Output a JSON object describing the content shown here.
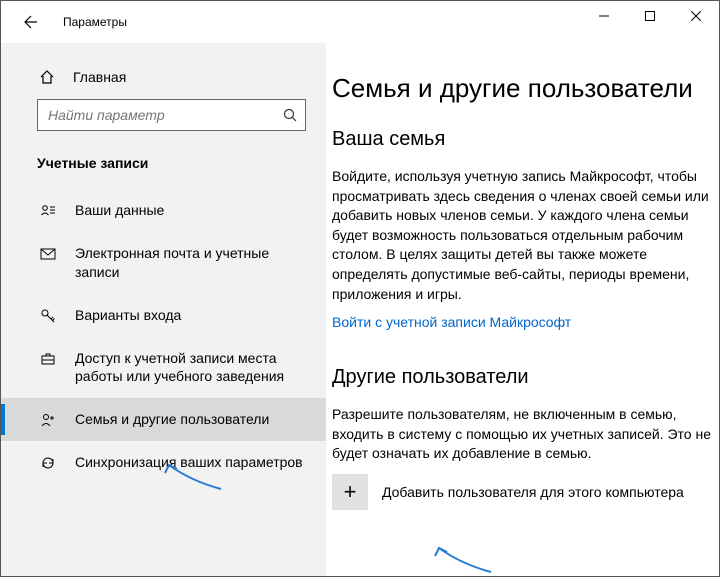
{
  "window": {
    "title": "Параметры"
  },
  "sidebar": {
    "home": "Главная",
    "search_placeholder": "Найти параметр",
    "section": "Учетные записи",
    "items": [
      {
        "label": "Ваши данные"
      },
      {
        "label": "Электронная почта и учетные записи"
      },
      {
        "label": "Варианты входа"
      },
      {
        "label": "Доступ к учетной записи места работы или учебного заведения"
      },
      {
        "label": "Семья и другие пользователи"
      },
      {
        "label": "Синхронизация ваших параметров"
      }
    ]
  },
  "main": {
    "title": "Семья и другие пользователи",
    "family": {
      "heading": "Ваша семья",
      "text": "Войдите, используя учетную запись Майкрософт, чтобы просматривать здесь сведения о членах своей семьи или добавить новых членов семьи. У каждого члена семьи будет возможность пользоваться отдельным рабочим столом. В целях защиты детей вы также можете определять допустимые веб-сайты, периоды времени, приложения и игры.",
      "link": "Войти с учетной записи Майкрософт"
    },
    "others": {
      "heading": "Другие пользователи",
      "text": "Разрешите пользователям, не включенным в семью, входить в систему с помощью их учетных записей. Это не будет означать их добавление в семью.",
      "add_label": "Добавить пользователя для этого компьютера"
    }
  }
}
